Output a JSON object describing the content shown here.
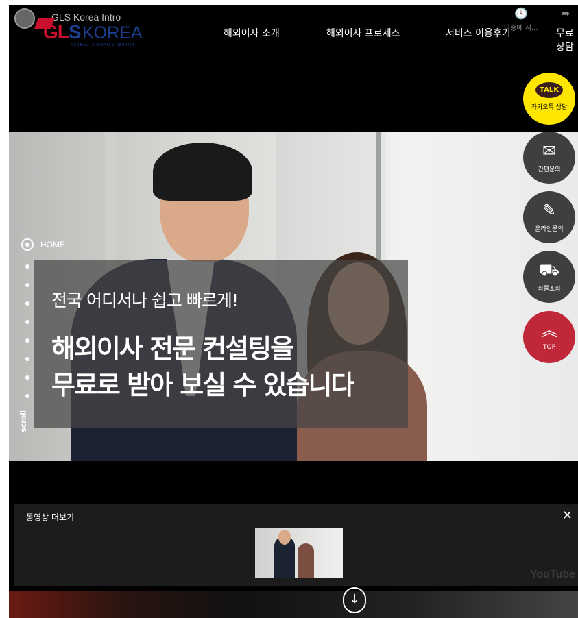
{
  "youtube": {
    "title": "GLS Korea Intro",
    "watch_later_label": "나중에 시...",
    "share_label": "공유",
    "brand": "YouTube",
    "clock_icon": "clock-icon",
    "share_icon": "share-icon"
  },
  "logo": {
    "gl": "GL",
    "s": "S",
    "korea": "KOREA",
    "tagline": "GLOBAL LOGISTICS SERVICE"
  },
  "nav": {
    "items": [
      "해외이사 소개",
      "해외이사 프로세스",
      "서비스 이용후기",
      "무료상담"
    ]
  },
  "hero": {
    "breadcrumb": "HOME",
    "subtitle": "전국 어디서나 쉽고 빠르게!",
    "headline_line1": "해외이사 전문 컨설팅을",
    "headline_line2": "무료로 받아 보실 수 있습니다",
    "scroll_label": "scroll"
  },
  "side_buttons": {
    "kakao_badge": "TALK",
    "kakao_label": "카카오톡 상담",
    "quick_label": "간편문의",
    "online_label": "온라인문의",
    "cargo_label": "화물조회",
    "top_label": "TOP"
  },
  "more_videos": {
    "title": "동영상 더보기",
    "close": "✕"
  },
  "colors": {
    "brand_red": "#c8102e",
    "brand_blue": "#1d3f8f",
    "kakao_yellow": "#ffe600",
    "top_red": "#c0283a"
  }
}
